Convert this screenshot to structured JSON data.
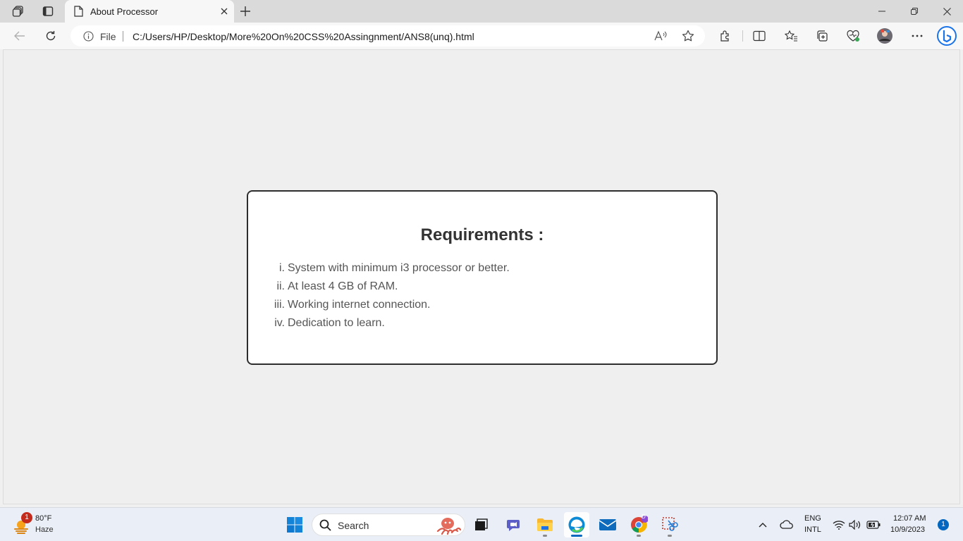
{
  "browser": {
    "tab": {
      "title": "About Processor"
    },
    "address_bar": {
      "scheme_label": "File",
      "url": "C:/Users/HP/Desktop/More%20On%20CSS%20Assingnment/ANS8(unq).html"
    }
  },
  "page": {
    "heading": "Requirements :",
    "items": [
      {
        "marker": "i.",
        "text": "System with minimum i3 processor or better."
      },
      {
        "marker": "ii.",
        "text": "At least 4 GB of RAM."
      },
      {
        "marker": "iii.",
        "text": "Working internet connection."
      },
      {
        "marker": "iv.",
        "text": "Dedication to learn."
      }
    ]
  },
  "taskbar": {
    "weather": {
      "temperature": "80°F",
      "condition": "Haze",
      "badge": "1"
    },
    "search_label": "Search",
    "language_line1": "ENG",
    "language_line2": "INTL",
    "time": "12:07 AM",
    "date": "10/9/2023",
    "notification_count": "1",
    "chrome_profile_letter": "D"
  },
  "colors": {
    "accent": "#0067c0",
    "card_border": "#2d2d2d",
    "page_background": "#efefef"
  }
}
